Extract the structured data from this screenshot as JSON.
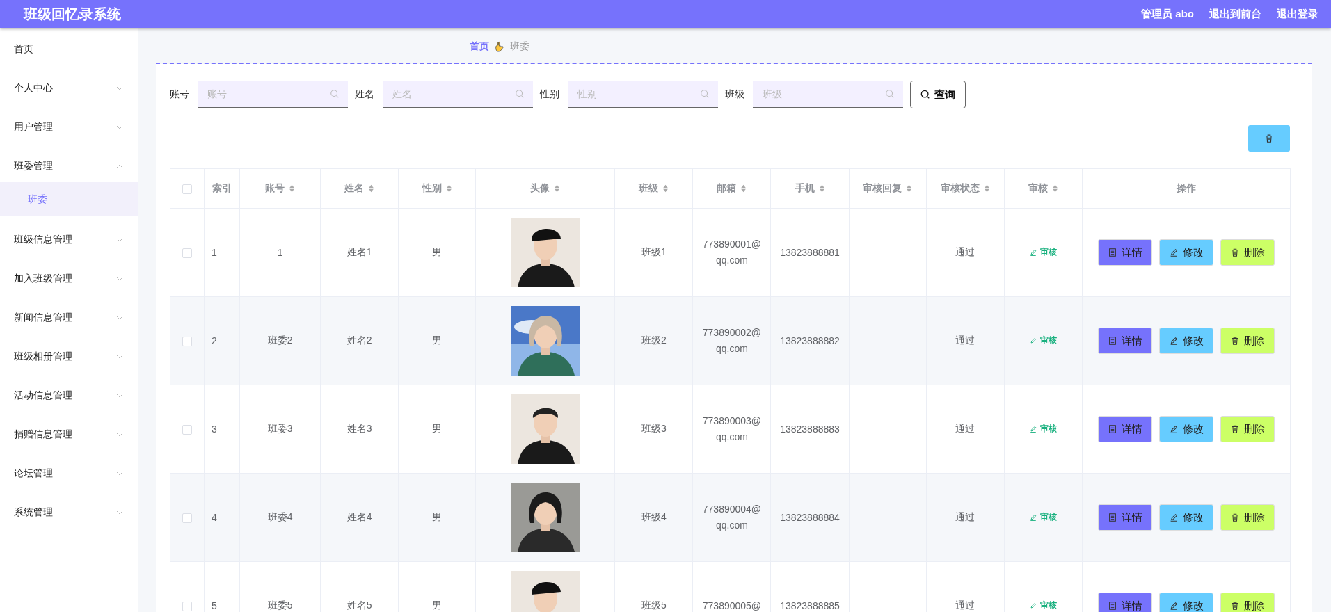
{
  "header": {
    "title": "班级回忆录系统",
    "links": [
      "管理员 abo",
      "退出到前台",
      "退出登录"
    ]
  },
  "sidebar": {
    "items": [
      {
        "label": "首页",
        "kind": "link",
        "selected": false
      },
      {
        "label": "个人中心",
        "kind": "submenu",
        "expanded": false,
        "selected": false
      },
      {
        "label": "用户管理",
        "kind": "submenu",
        "expanded": false,
        "selected": false
      },
      {
        "label": "班委管理",
        "kind": "submenu",
        "expanded": true,
        "selected": false,
        "children": [
          {
            "label": "班委",
            "selected": true
          }
        ]
      },
      {
        "label": "班级信息管理",
        "kind": "submenu",
        "expanded": false,
        "selected": false
      },
      {
        "label": "加入班级管理",
        "kind": "submenu",
        "expanded": false,
        "selected": false
      },
      {
        "label": "新闻信息管理",
        "kind": "submenu",
        "expanded": false,
        "selected": false
      },
      {
        "label": "班级相册管理",
        "kind": "submenu",
        "expanded": false,
        "selected": false
      },
      {
        "label": "活动信息管理",
        "kind": "submenu",
        "expanded": false,
        "selected": false
      },
      {
        "label": "捐赠信息管理",
        "kind": "submenu",
        "expanded": false,
        "selected": false
      },
      {
        "label": "论坛管理",
        "kind": "submenu",
        "expanded": false,
        "selected": false
      },
      {
        "label": "系统管理",
        "kind": "submenu",
        "expanded": false,
        "selected": false
      }
    ]
  },
  "breadcrumb": [
    {
      "label": "首页",
      "selected": false
    },
    {
      "label": "班委",
      "selected": true
    }
  ],
  "filters": [
    {
      "label": "账号",
      "placeholder": "账号"
    },
    {
      "label": "姓名",
      "placeholder": "姓名"
    },
    {
      "label": "性别",
      "placeholder": "性别"
    },
    {
      "label": "班级",
      "placeholder": "班级"
    }
  ],
  "query_button": "查询",
  "table": {
    "select_all": {
      "checked": false
    },
    "columns": [
      {
        "label": "索引",
        "sortable": false
      },
      {
        "label": "账号",
        "sortable": true
      },
      {
        "label": "姓名",
        "sortable": true
      },
      {
        "label": "性别",
        "sortable": true
      },
      {
        "label": "头像",
        "sortable": true
      },
      {
        "label": "班级",
        "sortable": true
      },
      {
        "label": "邮箱",
        "sortable": true
      },
      {
        "label": "手机",
        "sortable": true
      },
      {
        "label": "审核回复",
        "sortable": true
      },
      {
        "label": "审核状态",
        "sortable": true
      },
      {
        "label": "审核",
        "sortable": true
      },
      {
        "label": "操作",
        "sortable": false
      }
    ],
    "rows": [
      {
        "checked": false,
        "index": "1",
        "account": "1",
        "name": "姓名1",
        "gender": "男",
        "avatar": {
          "kind": "picture"
        },
        "class": "班级1",
        "email": "773890001@qq.com",
        "phone": "13823888881",
        "status": "通过",
        "audit": "审核",
        "actions": [
          {
            "label": "详情",
            "color": "#7672fc"
          },
          {
            "label": "修改",
            "color": "#66ccff"
          },
          {
            "label": "删除",
            "color": "#ccff66"
          }
        ]
      },
      {
        "checked": false,
        "index": "2",
        "account": "班委2",
        "name": "姓名2",
        "gender": "男",
        "avatar": {
          "kind": "picture"
        },
        "class": "班级2",
        "email": "773890002@qq.com",
        "phone": "13823888882",
        "status": "通过",
        "audit": "审核",
        "actions": [
          {
            "label": "详情",
            "color": "#7672fc"
          },
          {
            "label": "修改",
            "color": "#66ccff"
          },
          {
            "label": "删除",
            "color": "#ccff66"
          }
        ]
      },
      {
        "checked": false,
        "index": "3",
        "account": "班委3",
        "name": "姓名3",
        "gender": "男",
        "avatar": {
          "kind": "picture"
        },
        "class": "班级3",
        "email": "773890003@qq.com",
        "phone": "13823888883",
        "status": "通过",
        "audit": "审核",
        "actions": [
          {
            "label": "详情",
            "color": "#7672fc"
          },
          {
            "label": "修改",
            "color": "#66ccff"
          },
          {
            "label": "删除",
            "color": "#ccff66"
          }
        ]
      },
      {
        "checked": false,
        "index": "4",
        "account": "班委4",
        "name": "姓名4",
        "gender": "男",
        "avatar": {
          "kind": "picture"
        },
        "class": "班级4",
        "email": "773890004@qq.com",
        "phone": "13823888884",
        "status": "通过",
        "audit": "审核",
        "actions": [
          {
            "label": "详情",
            "color": "#7672fc"
          },
          {
            "label": "修改",
            "color": "#66ccff"
          },
          {
            "label": "删除",
            "color": "#ccff66"
          }
        ]
      },
      {
        "checked": false,
        "index": "5",
        "account": "班委5",
        "name": "姓名5",
        "gender": "男",
        "avatar": {
          "kind": "picture"
        },
        "class": "班级5",
        "email": "773890005@",
        "phone": "13823888885",
        "status": "通过",
        "audit": "审核",
        "actions": [
          {
            "label": "详情",
            "color": "#7672fc"
          },
          {
            "label": "修改",
            "color": "#66ccff"
          },
          {
            "label": "删除",
            "color": "#ccff66"
          }
        ]
      }
    ]
  }
}
